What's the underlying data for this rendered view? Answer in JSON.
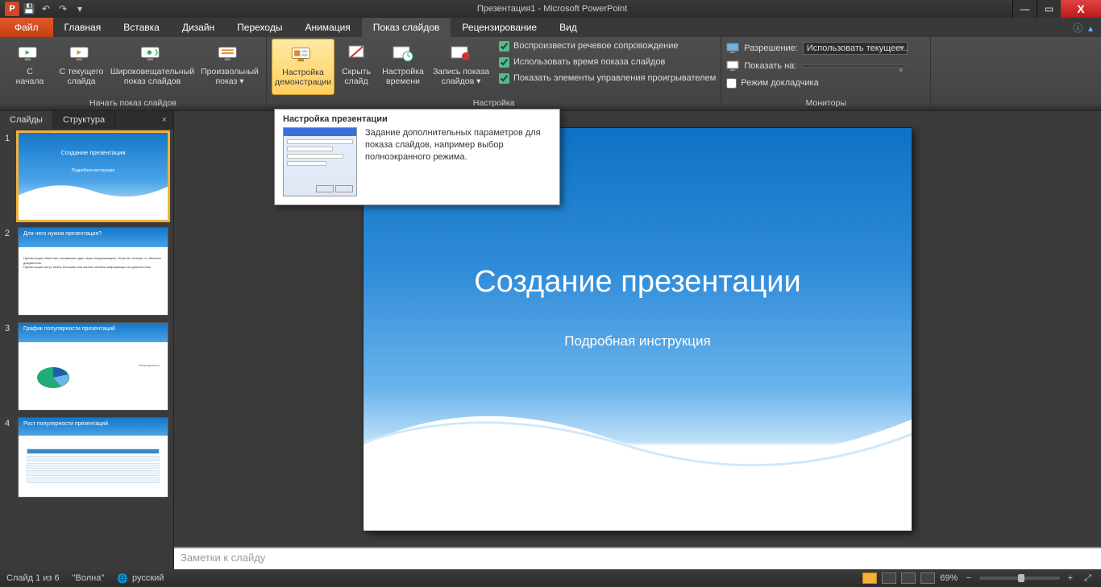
{
  "title": "Презентация1 - Microsoft PowerPoint",
  "qat": {
    "undo": "↶",
    "redo": "↷",
    "save": "💾",
    "dropdown": "▾"
  },
  "win": {
    "min": "—",
    "max": "▭",
    "close": "X"
  },
  "tabs": {
    "file": "Файл",
    "list": [
      "Главная",
      "Вставка",
      "Дизайн",
      "Переходы",
      "Анимация",
      "Показ слайдов",
      "Рецензирование",
      "Вид"
    ],
    "active_index": 5
  },
  "ribbon": {
    "g1": {
      "label": "Начать показ слайдов",
      "from_start": "С\nначала",
      "from_current": "С текущего\nслайда",
      "broadcast": "Широковещательный\nпоказ слайдов",
      "custom": "Произвольный\nпоказ ▾"
    },
    "g2": {
      "label": "Настройка",
      "setup": "Настройка\nдемонстрации",
      "hide": "Скрыть\nслайд",
      "rehearse": "Настройка\nвремени",
      "record": "Запись показа\nслайдов ▾",
      "chk_narration": "Воспроизвести речевое сопровождение",
      "chk_timings": "Использовать время показа слайдов",
      "chk_controls": "Показать элементы управления проигрывателем"
    },
    "g3": {
      "label": "Мониторы",
      "resolution_label": "Разрешение:",
      "resolution_value": "Использовать текущее...",
      "show_on_label": "Показать на:",
      "show_on_value": "",
      "presenter": "Режим докладчика"
    }
  },
  "tooltip": {
    "title": "Настройка презентации",
    "text": "Задание дополнительных параметров для показа слайдов, например выбор полноэкранного режима."
  },
  "pane": {
    "tabs": [
      "Слайды",
      "Структура"
    ],
    "close": "×"
  },
  "thumbs": [
    {
      "n": "1",
      "title": "Создание презентации",
      "sub": "Подробная инструкция"
    },
    {
      "n": "2",
      "headline": "Для чего нужна презентация?",
      "body": "Презентация облегчает понимание идеи через визуализацию. Этим её отличие от обычных документов.\nПрезентации могут иметь большие или малые объёмы информации по данной теме."
    },
    {
      "n": "3",
      "headline": "График популярности презентаций",
      "legend": "Популярность"
    },
    {
      "n": "4",
      "headline": "Рост популярности презентаций"
    }
  ],
  "main_slide": {
    "title": "Создание презентации",
    "sub": "Подробная инструкция"
  },
  "notes_placeholder": "Заметки к слайду",
  "status": {
    "slide": "Слайд 1 из 6",
    "theme": "\"Волна\"",
    "lang": "русский",
    "zoom": "69%",
    "fit": "⤢"
  }
}
